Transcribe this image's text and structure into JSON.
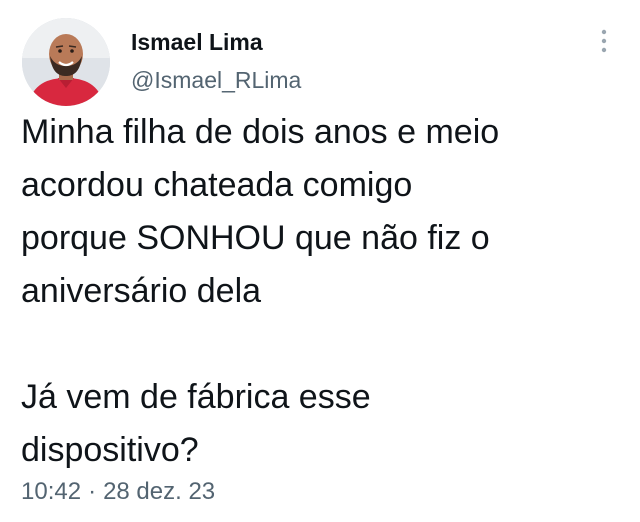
{
  "author": {
    "name": "Ismael Lima",
    "handle": "@Ismael_RLima",
    "avatar_icon": "profile-photo"
  },
  "menu": {
    "icon": "more-vertical-icon"
  },
  "tweet": {
    "lines_paragraph_1": [
      "Minha filha de dois anos e meio",
      "acordou chateada comigo",
      "porque SONHOU que não fiz o",
      "aniversário dela"
    ],
    "lines_paragraph_2": [
      "Já vem de fábrica esse",
      "dispositivo?"
    ],
    "time": "10:42",
    "separator": "·",
    "date": "28 dez. 23"
  },
  "colors": {
    "text": "#0f1419",
    "secondary": "#536471",
    "shirt": "#d8283f"
  }
}
